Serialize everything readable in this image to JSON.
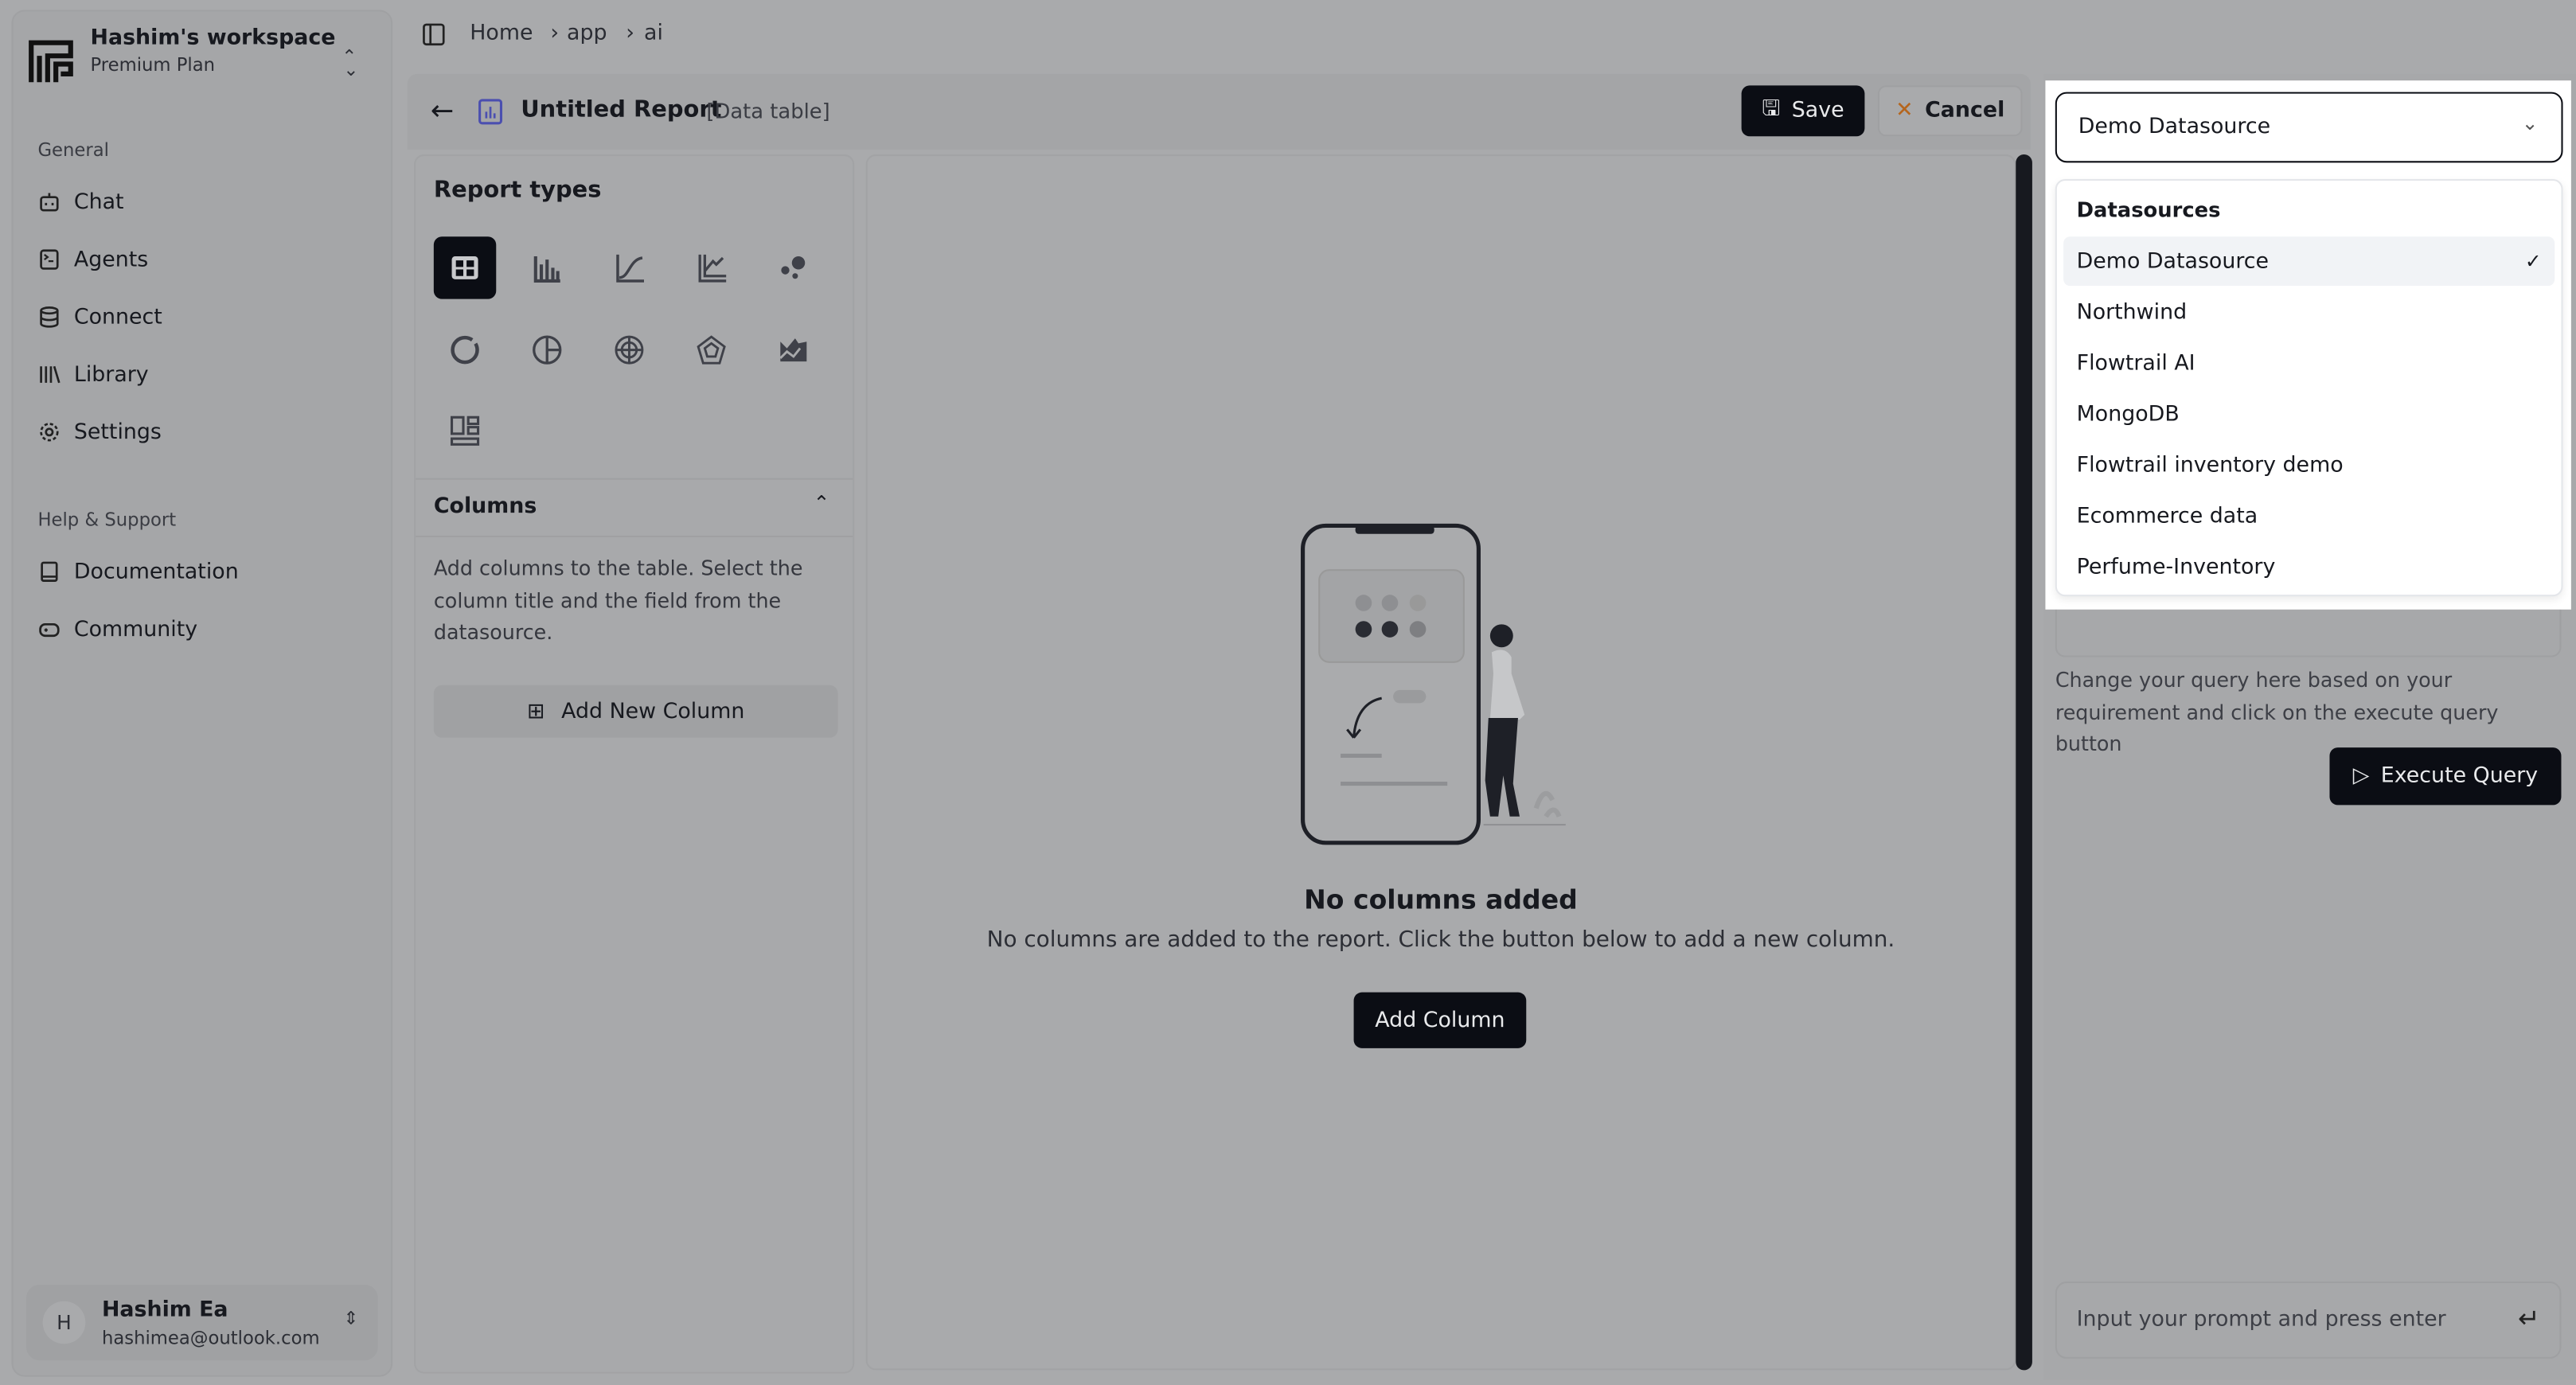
{
  "workspace": {
    "name": "Hashim's workspace",
    "plan": "Premium Plan"
  },
  "sidebar": {
    "general_label": "General",
    "items": [
      {
        "label": "Chat",
        "icon": "bot-icon"
      },
      {
        "label": "Agents",
        "icon": "terminal-icon"
      },
      {
        "label": "Connect",
        "icon": "database-icon"
      },
      {
        "label": "Library",
        "icon": "library-icon"
      },
      {
        "label": "Settings",
        "icon": "gear-icon"
      }
    ],
    "help_label": "Help & Support",
    "help_items": [
      {
        "label": "Documentation",
        "icon": "book-icon"
      },
      {
        "label": "Community",
        "icon": "gamepad-icon"
      }
    ]
  },
  "user": {
    "initial": "H",
    "name": "Hashim Ea",
    "email": "hashimea@outlook.com"
  },
  "breadcrumb": [
    "Home",
    "app",
    "ai"
  ],
  "report": {
    "title": "Untitled Report",
    "type": "[Data table]",
    "save": "Save",
    "cancel": "Cancel"
  },
  "report_types": {
    "title": "Report types",
    "selected": "table",
    "items": [
      "table",
      "bar",
      "line",
      "multi-line",
      "scatter",
      "donut",
      "pie",
      "radial",
      "radar",
      "area",
      "dashboard"
    ]
  },
  "columns": {
    "title": "Columns",
    "description": "Add columns to the table. Select the column title and the field from the datasource.",
    "add_button": "Add New Column"
  },
  "empty": {
    "title": "No columns added",
    "text": "No columns are added to the report. Click the button below to add a new column.",
    "button": "Add Column"
  },
  "datasource": {
    "selected": "Demo Datasource",
    "group_label": "Datasources",
    "options": [
      "Demo Datasource",
      "Northwind",
      "Flowtrail AI",
      "MongoDB",
      "Flowtrail inventory demo",
      "Ecommerce data",
      "Perfume-Inventory"
    ]
  },
  "query": {
    "hint": "Change your query here based on your requirement and click on the execute query button",
    "execute": "Execute Query"
  },
  "prompt": {
    "placeholder": "Input your prompt and press enter"
  }
}
